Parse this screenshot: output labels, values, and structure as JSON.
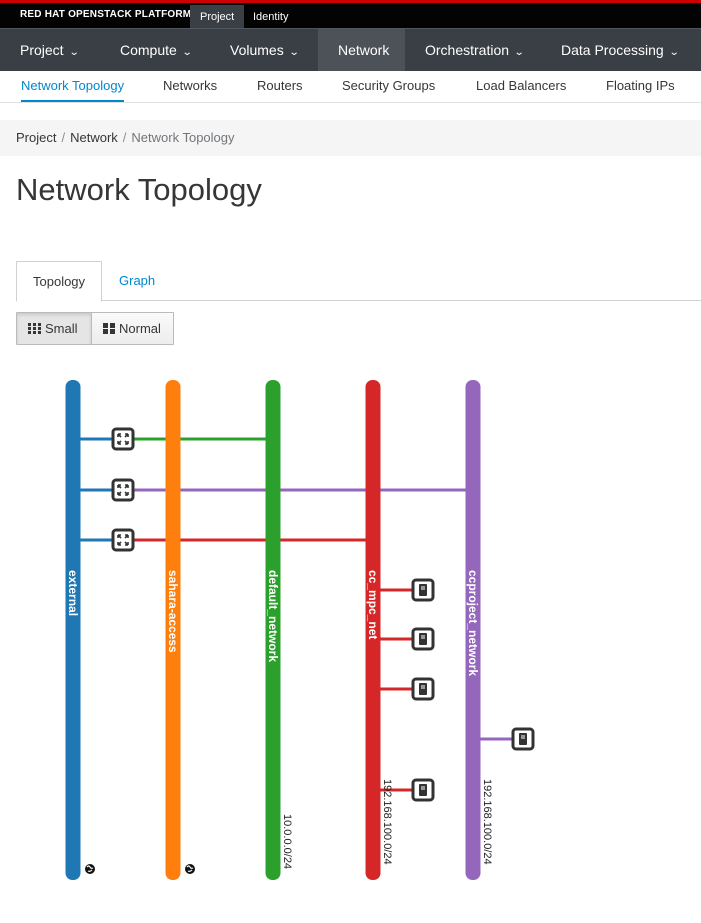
{
  "brand": "RED HAT OPENSTACK PLATFORM",
  "context_tabs": [
    "Project",
    "Identity"
  ],
  "primary_nav": [
    "Project",
    "Compute",
    "Volumes",
    "Network",
    "Orchestration",
    "Data Processing"
  ],
  "secondary_nav": [
    "Network Topology",
    "Networks",
    "Routers",
    "Security Groups",
    "Load Balancers",
    "Floating IPs"
  ],
  "breadcrumb": [
    "Project",
    "Network",
    "Network Topology"
  ],
  "page_title": "Network Topology",
  "tabs": [
    "Topology",
    "Graph"
  ],
  "size_buttons": [
    "Small",
    "Normal"
  ],
  "topology": {
    "networks": [
      {
        "name": "external",
        "color": "#1f77b4",
        "cidr": "",
        "external": true
      },
      {
        "name": "sahara-access",
        "color": "#ff7f0e",
        "cidr": "",
        "external": true
      },
      {
        "name": "default_network",
        "color": "#2ca02c",
        "cidr": "10.0.0.0/24",
        "external": false
      },
      {
        "name": "cc_mpc_net",
        "color": "#d62728",
        "cidr": "192.168.100.0/24",
        "external": false
      },
      {
        "name": "ccproject_network",
        "color": "#9467bd",
        "cidr": "192.168.100.0/24",
        "external": false
      }
    ],
    "routers": [
      {
        "gateway": "external",
        "interface": "default_network"
      },
      {
        "gateway": "external",
        "interface": "ccproject_network"
      },
      {
        "gateway": "external",
        "interface": "cc_mpc_net"
      }
    ],
    "instances": [
      {
        "network": "cc_mpc_net"
      },
      {
        "network": "cc_mpc_net"
      },
      {
        "network": "cc_mpc_net"
      },
      {
        "network": "ccproject_network"
      },
      {
        "network": "cc_mpc_net"
      }
    ]
  }
}
